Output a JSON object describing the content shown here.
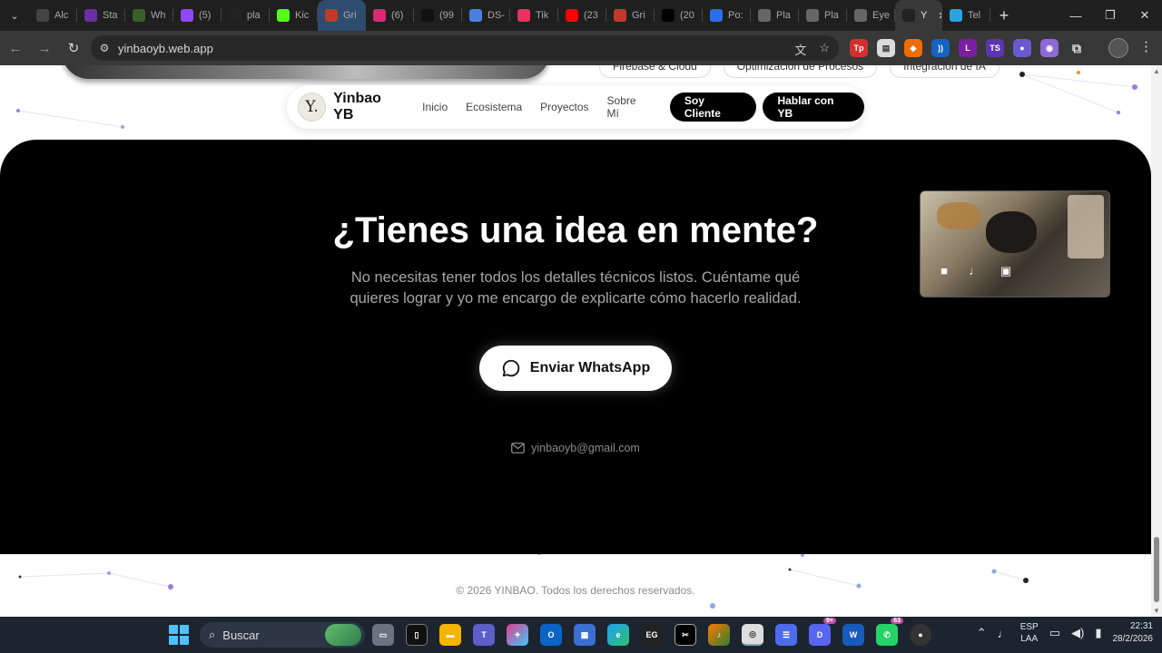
{
  "browser": {
    "tabs": [
      {
        "label": "Alc",
        "favicon": "square-icon",
        "color": "#444444"
      },
      {
        "label": "Sta",
        "favicon": "circle-icon",
        "color": "#6a2fa0"
      },
      {
        "label": "Wh",
        "favicon": "leaf-icon",
        "color": "#3a5f2a"
      },
      {
        "label": "(5)",
        "favicon": "twitch-icon",
        "color": "#9146ff"
      },
      {
        "label": "pla",
        "favicon": "record-icon",
        "color": "#222222"
      },
      {
        "label": "Kic",
        "favicon": "kick-icon",
        "color": "#53fc18"
      },
      {
        "label": "Gri",
        "favicon": "gallery-icon",
        "color": "#c0392b"
      },
      {
        "label": "(6)",
        "favicon": "instagram-icon",
        "color": "#d62976"
      },
      {
        "label": "(99",
        "favicon": "tiktok-icon",
        "color": "#111111"
      },
      {
        "label": "DS-",
        "favicon": "doc-icon",
        "color": "#4a7fe0"
      },
      {
        "label": "Tik",
        "favicon": "tiktok-app-icon",
        "color": "#e8335f"
      },
      {
        "label": "(23",
        "favicon": "youtube-icon",
        "color": "#ff0000"
      },
      {
        "label": "Gri",
        "favicon": "gallery-icon",
        "color": "#c0392b"
      },
      {
        "label": "(20",
        "favicon": "x-icon",
        "color": "#000000"
      },
      {
        "label": "Po:",
        "favicon": "zoom-icon",
        "color": "#2d6ee8"
      },
      {
        "label": "Pla",
        "favicon": "globe-icon",
        "color": "#666666"
      },
      {
        "label": "Pla",
        "favicon": "globe-icon",
        "color": "#666666"
      },
      {
        "label": "Eye",
        "favicon": "globe-icon",
        "color": "#666666"
      },
      {
        "label": "Y",
        "favicon": "y-icon",
        "color": "#222222"
      },
      {
        "label": "Tel",
        "favicon": "telegram-icon",
        "color": "#2aa3e0"
      }
    ],
    "new_tab": "+",
    "url": "yinbaoyb.web.app"
  },
  "page": {
    "chips": [
      "Firebase & Cloud",
      "Optimización de Procesos",
      "Integración de IA"
    ],
    "nav": {
      "logo_letter": "Y.",
      "brand": "Yinbao YB",
      "links": [
        "Inicio",
        "Ecosistema",
        "Proyectos",
        "Sobre Mí"
      ],
      "btn_client": "Soy Cliente",
      "btn_talk": "Hablar con YB"
    },
    "cta": {
      "title": "¿Tienes una idea en mente?",
      "subtitle": "No necesitas tener todos los detalles técnicos listos. Cuéntame qué quieres lograr y yo me encargo de explicarte cómo hacerlo realidad.",
      "button": "Enviar WhatsApp",
      "email": "yinbaoyb@gmail.com"
    },
    "footer": "© 2026 YINBAO. Todos los derechos reservados."
  },
  "taskbar": {
    "search_placeholder": "Buscar",
    "badges": {
      "discord": "9+",
      "whatsapp": "63"
    },
    "lang_line1": "ESP",
    "lang_line2": "LAA",
    "time": "22:31",
    "date": "28/2/2026"
  },
  "colors": {
    "cta_bg": "#000000",
    "accent_dots": "#9b7bd8",
    "taskbar_bg": "#1c2430"
  }
}
